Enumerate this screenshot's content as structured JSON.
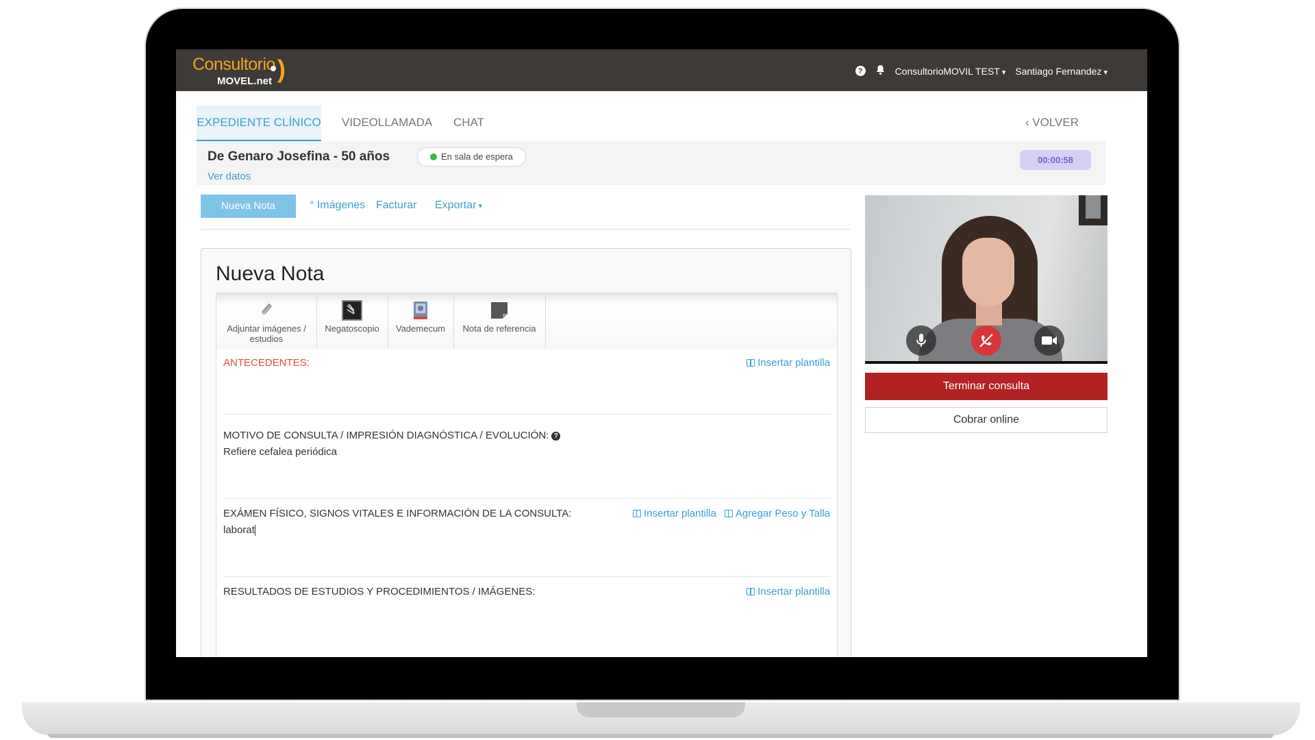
{
  "app": {
    "logo_main": "Consultorio",
    "logo_sub": "MOVEL.net",
    "account": "ConsultorioMOVIL TEST",
    "user": "Santiago Fernandez"
  },
  "tabs": [
    {
      "label": "EXPEDIENTE CLÍNICO",
      "active": true
    },
    {
      "label": "VIDEOLLAMADA",
      "active": false
    },
    {
      "label": "CHAT",
      "active": false
    }
  ],
  "back_label": "VOLVER",
  "patient": {
    "name": "De Genaro Josefina - 50 años",
    "status": "En sala de espera",
    "view_data": "Ver datos",
    "timer": "00:00:58"
  },
  "note_actions": {
    "new_note": "Nueva Nota",
    "images": "° Imágenes",
    "invoice": "Facturar",
    "export": "Exportar"
  },
  "note": {
    "title": "Nueva Nota",
    "tools": [
      {
        "label": "Adjuntar imágenes / estudios",
        "icon": "paperclip-icon"
      },
      {
        "label": "Negatoscopio",
        "icon": "xray-icon"
      },
      {
        "label": "Vademecum",
        "icon": "book-icon"
      },
      {
        "label": "Nota de referencia",
        "icon": "note-icon"
      }
    ],
    "sections": [
      {
        "label": "ANTECEDENTES:",
        "value": "",
        "links": [
          "Insertar plantilla"
        ]
      },
      {
        "label": "MOTIVO DE CONSULTA / IMPRESIÓN DIAGNÓSTICA / EVOLUCIÓN:",
        "value": "Refiere cefalea periódica",
        "links": []
      },
      {
        "label": "EXÁMEN FÍSICO, SIGNOS VITALES E INFORMACIÓN DE LA CONSULTA:",
        "value": "laborat",
        "links": [
          "Insertar plantilla",
          "Agregar Peso y Talla"
        ]
      },
      {
        "label": "RESULTADOS DE ESTUDIOS Y PROCEDIMIENTOS / IMÁGENES:",
        "value": "",
        "links": [
          "Insertar plantilla"
        ]
      }
    ]
  },
  "call": {
    "end_label": "Terminar consulta",
    "charge_label": "Cobrar online"
  },
  "colors": {
    "header_bg": "#3d3a37",
    "brand_orange": "#f7a21b",
    "link_blue": "#3ba0cf",
    "end_red": "#b22222",
    "timer_bg": "#d8d0f4"
  }
}
